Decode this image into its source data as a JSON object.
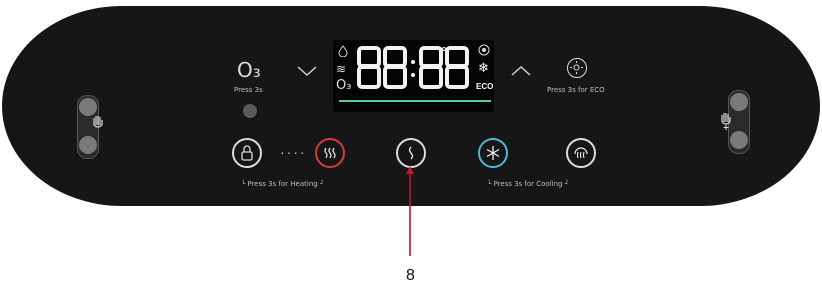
{
  "panel": {
    "o3_symbol": "O₃",
    "o3_press_label": "Press 3s",
    "eco_press_label": "Press 3s for ECO",
    "heating_label": "└ Press 3s for Heating ┘",
    "cooling_label": "└ Press 3s for Cooling ┘",
    "dots": "····"
  },
  "display": {
    "digits": "88:88",
    "eco_text": "ECO",
    "o3_text": "O₃",
    "wave_text": "≋"
  },
  "callout": {
    "number": "8"
  },
  "colors": {
    "panel": "#161616",
    "heating_accent": "#d33c3c",
    "cooling_accent": "#4fb7d2",
    "display_bar": "#5ec9a8",
    "callout_line": "#c41230"
  }
}
